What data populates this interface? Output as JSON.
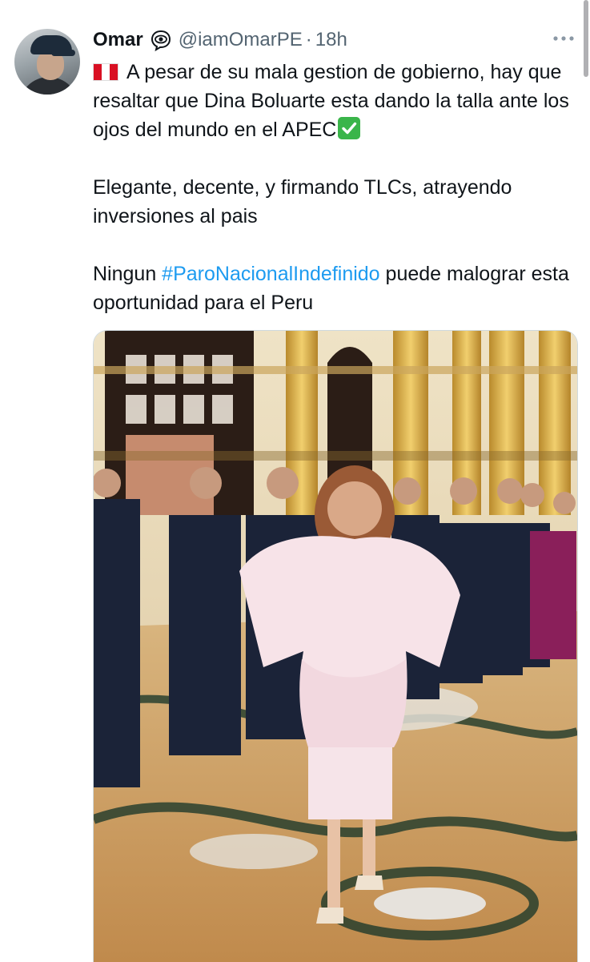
{
  "tweet": {
    "author": {
      "name": "Omar",
      "handle": "@iamOmarPE",
      "separator": "·",
      "time": "18h",
      "badge_icon": "eye-in-speech-bubble-icon",
      "avatar_icon": "user-avatar"
    },
    "more_icon": "more-horizontal-icon",
    "paragraphs": {
      "p1_text": "A pesar de su mala gestion de gobierno, hay que resaltar que Dina Boluarte esta dando la talla ante los ojos del mundo en el APEC",
      "p2_text": "Elegante, decente, y firmando TLCs, atrayendo inversiones al pais",
      "p3_before": "Ningun ",
      "p3_hashtag": "#ParoNacionalIndefinido",
      "p3_after": " puede malograr esta oportunidad para el Peru"
    },
    "emoji": {
      "leading": "peru-flag-icon",
      "trailing": "check-mark-button-icon"
    },
    "media": {
      "kind": "photo",
      "icon": "photo"
    },
    "colors": {
      "link": "#1d9bf0",
      "text": "#0f1419",
      "secondary": "#536471"
    }
  }
}
